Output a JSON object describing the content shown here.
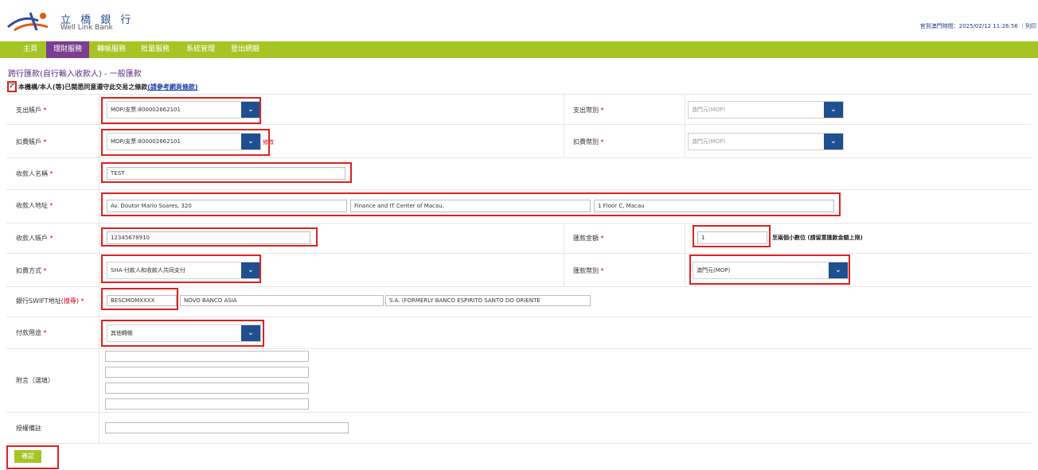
{
  "header": {
    "logo_cn": "立 橋 銀 行",
    "logo_en": "Well Link Bank",
    "server_time_label": "官到澳門時間：",
    "server_time_value": "2025/02/12 11:26:56",
    "server_time_tail": "｜列印"
  },
  "nav": {
    "items": [
      {
        "label": "主頁"
      },
      {
        "label": "理財服務"
      },
      {
        "label": "轉帳服務"
      },
      {
        "label": "批量服務"
      },
      {
        "label": "系統管理"
      },
      {
        "label": "登出網銀"
      }
    ],
    "active_index": 1
  },
  "page": {
    "title": "跨行匯款(自行輸入收款人) - 一般匯款",
    "agree_text": "本機構/本人(等)已閱悉同意遵守此交易之條款",
    "agree_link": "(請參考網頁條款)"
  },
  "form": {
    "debit_account": {
      "label": "支出賬戶",
      "value": "MOP/支票:800002662101"
    },
    "debit_currency": {
      "label": "支出幣別",
      "value": "澳門元(MOP)"
    },
    "charge_account": {
      "label": "扣費賬戶",
      "value": "MOP/支票:800002662101",
      "note": "修改"
    },
    "charge_currency": {
      "label": "扣費幣別",
      "value": "澳門元(MOP)"
    },
    "payee_name": {
      "label": "收款人名稱",
      "value": "TEST"
    },
    "payee_address": {
      "label": "收款人地址",
      "lines": [
        "Av. Doutor Mario Soares, 320",
        "Finance and IT Center of Macau,",
        "1 Floor C, Macau"
      ]
    },
    "payee_account": {
      "label": "收款人賬戶",
      "value": "12345678910"
    },
    "remit_amount": {
      "label": "匯款金額",
      "value": "1",
      "note": "至兩個小數位 (請留意匯款金額上限)"
    },
    "charge_method": {
      "label": "扣費方式",
      "value": "SHA-付款人和收款人共同支付"
    },
    "remit_currency": {
      "label": "匯款幣別",
      "value": "澳門元(MOP)"
    },
    "bank_swift": {
      "label": "銀行SWIFT地址",
      "link": "(搜尋)",
      "value": "BESCMOMXXXX",
      "bank_name": "NOVO BANCO ASIA",
      "bank_name2": "S.A. (FORMERLY BANCO ESPIRITO SANTO DO ORIENTE"
    },
    "purpose": {
      "label": "付款用途",
      "value": "其他轉帳"
    },
    "remarks": {
      "label": "附言（選填）"
    },
    "fax_remark": {
      "label": "授權備註"
    }
  },
  "confirm_label": "確認"
}
